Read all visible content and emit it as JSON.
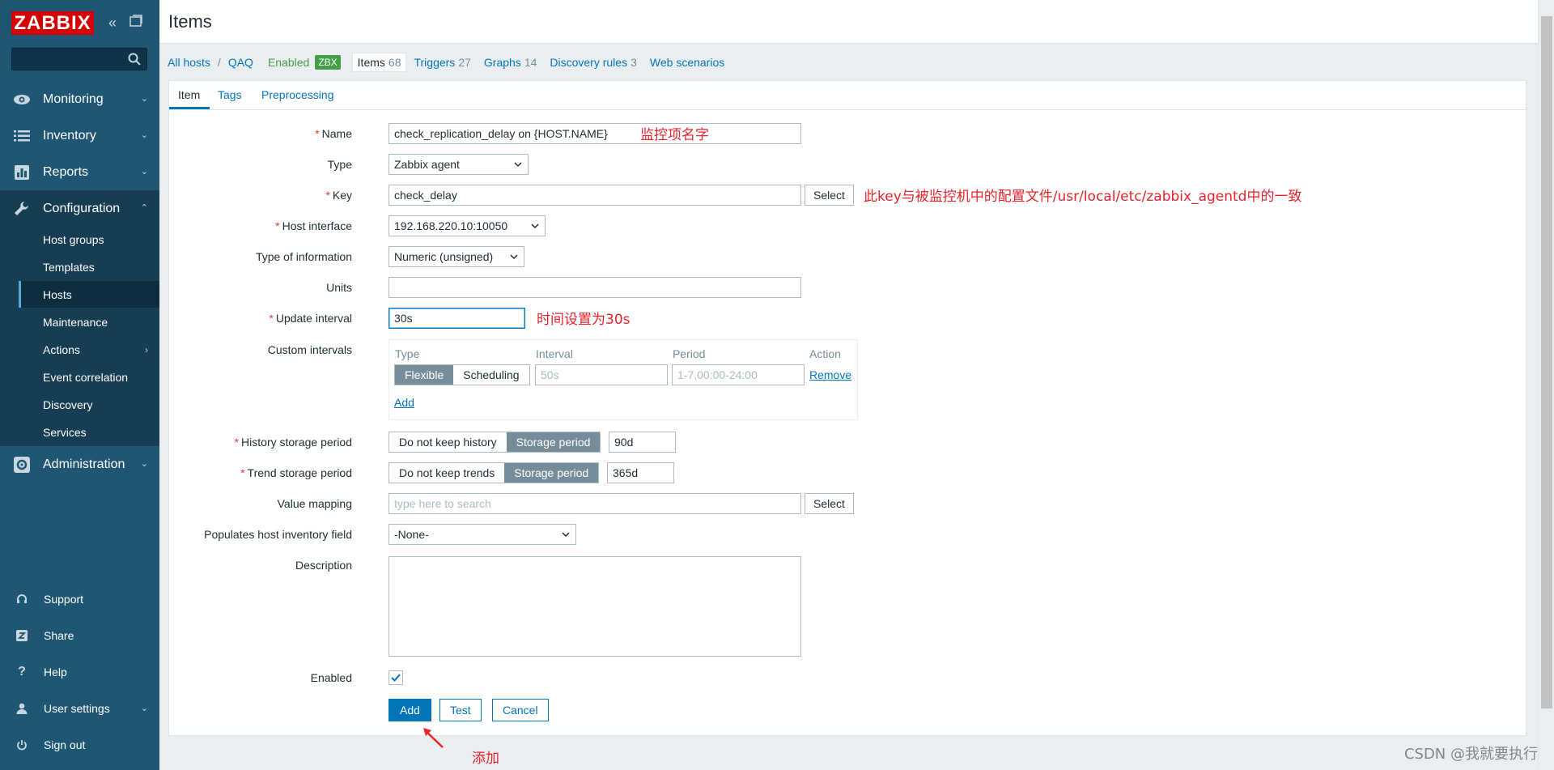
{
  "sidebar": {
    "logo": "ZABBIX",
    "search": {
      "placeholder": ""
    },
    "menu": [
      {
        "label": "Monitoring",
        "icon": "eye-icon"
      },
      {
        "label": "Inventory",
        "icon": "list-icon"
      },
      {
        "label": "Reports",
        "icon": "bar-chart-icon"
      },
      {
        "label": "Configuration",
        "icon": "wrench-icon",
        "expanded": true
      },
      {
        "label": "Administration",
        "icon": "gear-icon"
      }
    ],
    "submenu": [
      {
        "label": "Host groups"
      },
      {
        "label": "Templates"
      },
      {
        "label": "Hosts",
        "current": true
      },
      {
        "label": "Maintenance"
      },
      {
        "label": "Actions",
        "has_children": true
      },
      {
        "label": "Event correlation"
      },
      {
        "label": "Discovery"
      },
      {
        "label": "Services"
      }
    ],
    "bottom": [
      {
        "label": "Support",
        "icon": "headset-icon"
      },
      {
        "label": "Share",
        "icon": "share-z-icon"
      },
      {
        "label": "Help",
        "icon": "question-icon"
      },
      {
        "label": "User settings",
        "icon": "user-icon"
      },
      {
        "label": "Sign out",
        "icon": "power-icon"
      }
    ]
  },
  "header": {
    "title": "Items"
  },
  "breadcrumbs": {
    "all_hosts": "All hosts",
    "separator": "/",
    "host": "QAQ",
    "enabled": "Enabled",
    "zbx": "ZBX",
    "items": {
      "label": "Items",
      "count": "68"
    },
    "triggers": {
      "label": "Triggers",
      "count": "27"
    },
    "graphs": {
      "label": "Graphs",
      "count": "14"
    },
    "discovery": {
      "label": "Discovery rules",
      "count": "3"
    },
    "web": {
      "label": "Web scenarios"
    }
  },
  "tabs": [
    "Item",
    "Tags",
    "Preprocessing"
  ],
  "form": {
    "name": {
      "label": "Name",
      "value": "check_replication_delay on {HOST.NAME}"
    },
    "type": {
      "label": "Type",
      "value": "Zabbix agent"
    },
    "key": {
      "label": "Key",
      "value": "check_delay",
      "button": "Select"
    },
    "host_interface": {
      "label": "Host interface",
      "value": "192.168.220.10:10050"
    },
    "type_of_information": {
      "label": "Type of information",
      "value": "Numeric (unsigned)"
    },
    "units": {
      "label": "Units",
      "value": ""
    },
    "update_interval": {
      "label": "Update interval",
      "value": "30s"
    },
    "custom_intervals": {
      "label": "Custom intervals",
      "headers": {
        "type": "Type",
        "interval": "Interval",
        "period": "Period",
        "action": "Action"
      },
      "row": {
        "flexible": "Flexible",
        "scheduling": "Scheduling",
        "interval_placeholder": "50s",
        "period_placeholder": "1-7,00:00-24:00",
        "remove": "Remove"
      },
      "add": "Add"
    },
    "history": {
      "label": "History storage period",
      "opt1": "Do not keep history",
      "opt2": "Storage period",
      "value": "90d"
    },
    "trend": {
      "label": "Trend storage period",
      "opt1": "Do not keep trends",
      "opt2": "Storage period",
      "value": "365d"
    },
    "value_mapping": {
      "label": "Value mapping",
      "placeholder": "type here to search",
      "button": "Select"
    },
    "inventory": {
      "label": "Populates host inventory field",
      "value": "-None-"
    },
    "description": {
      "label": "Description",
      "value": ""
    },
    "enabled": {
      "label": "Enabled",
      "checked": true
    }
  },
  "actions": {
    "add": "Add",
    "test": "Test",
    "cancel": "Cancel"
  },
  "annotations": {
    "name_note": "监控项名字",
    "key_note": "此key与被监控机中的配置文件/usr/local/etc/zabbix_agentd中的一致",
    "interval_note": "时间设置为30s",
    "add_note": "添加"
  },
  "watermark": "CSDN @我就要执行",
  "colors": {
    "sidebar": "#1f5673",
    "accent": "#0275b8",
    "annotation": "#e8232b",
    "logo": "#d40000"
  }
}
